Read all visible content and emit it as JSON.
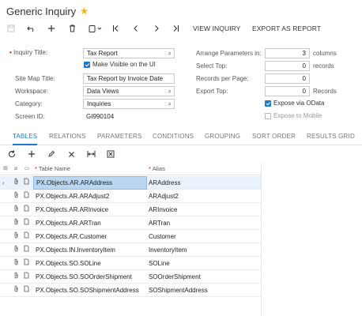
{
  "header": {
    "title": "Generic Inquiry",
    "star_glyph": "★"
  },
  "toolbar": {
    "icons": [
      "save-icon",
      "undo-icon",
      "add-icon",
      "delete-icon",
      "copy-paste-icon",
      "first-icon",
      "prev-icon",
      "next-icon",
      "last-icon"
    ],
    "view_inquiry_label": "VIEW INQUIRY",
    "export_label": "EXPORT AS REPORT"
  },
  "form": {
    "inquiry_title_label": "Inquiry Title:",
    "inquiry_title_value": "Tax Report",
    "make_visible_label": "Make Visible on the UI",
    "make_visible_checked": true,
    "site_map_title_label": "Site Map Title:",
    "site_map_title_value": "Tax Report by Invoice Date",
    "workspace_label": "Workspace:",
    "workspace_value": "Data Views",
    "category_label": "Category:",
    "category_value": "Inquiries",
    "screen_id_label": "Screen ID:",
    "screen_id_value": "GI990104",
    "arrange_label": "Arrange Parameters in:",
    "arrange_value": "3",
    "arrange_unit": "columns",
    "select_top_label": "Select Top:",
    "select_top_value": "0",
    "select_top_unit": "records",
    "records_per_page_label": "Records per Page:",
    "records_per_page_value": "0",
    "export_top_label": "Export Top:",
    "export_top_value": "0",
    "export_top_unit": "Records",
    "expose_odata_label": "Expose via OData",
    "expose_odata_checked": true,
    "expose_mobile_label": "Expose to Mobile",
    "expose_mobile_checked": false
  },
  "tabs": [
    "TABLES",
    "RELATIONS",
    "PARAMETERS",
    "CONDITIONS",
    "GROUPING",
    "SORT ORDER",
    "RESULTS GRID"
  ],
  "active_tab": "TABLES",
  "grid_toolbar": [
    "refresh-icon",
    "add-row-icon",
    "edit-icon",
    "delete-row-icon",
    "fit-columns-icon",
    "export-excel-icon"
  ],
  "grid": {
    "columns": {
      "table_name": "Table Name",
      "alias": "Alias"
    },
    "rows": [
      {
        "table_name": "PX.Objects.AR.ARAddress",
        "alias": "ARAddress"
      },
      {
        "table_name": "PX.Objects.AR.ARAdjust2",
        "alias": "ARAdjust2"
      },
      {
        "table_name": "PX.Objects.AR.ARInvoice",
        "alias": "ARInvoice"
      },
      {
        "table_name": "PX.Objects.AR.ARTran",
        "alias": "ARTran"
      },
      {
        "table_name": "PX.Objects.AR.Customer",
        "alias": "Customer"
      },
      {
        "table_name": "PX.Objects.IN.InventoryItem",
        "alias": "InventoryItem"
      },
      {
        "table_name": "PX.Objects.SO.SOLine",
        "alias": "SOLine"
      },
      {
        "table_name": "PX.Objects.SO.SOOrderShipment",
        "alias": "SOOrderShipment"
      },
      {
        "table_name": "PX.Objects.SO.SOShipmentAddress",
        "alias": "SOShipmentAddress"
      }
    ]
  },
  "colors": {
    "accent": "#1c7ad6",
    "selected_row": "#eaf3fb",
    "selected_cell": "#b9d7f1",
    "star": "#f5b400",
    "required": "#cc0000"
  }
}
